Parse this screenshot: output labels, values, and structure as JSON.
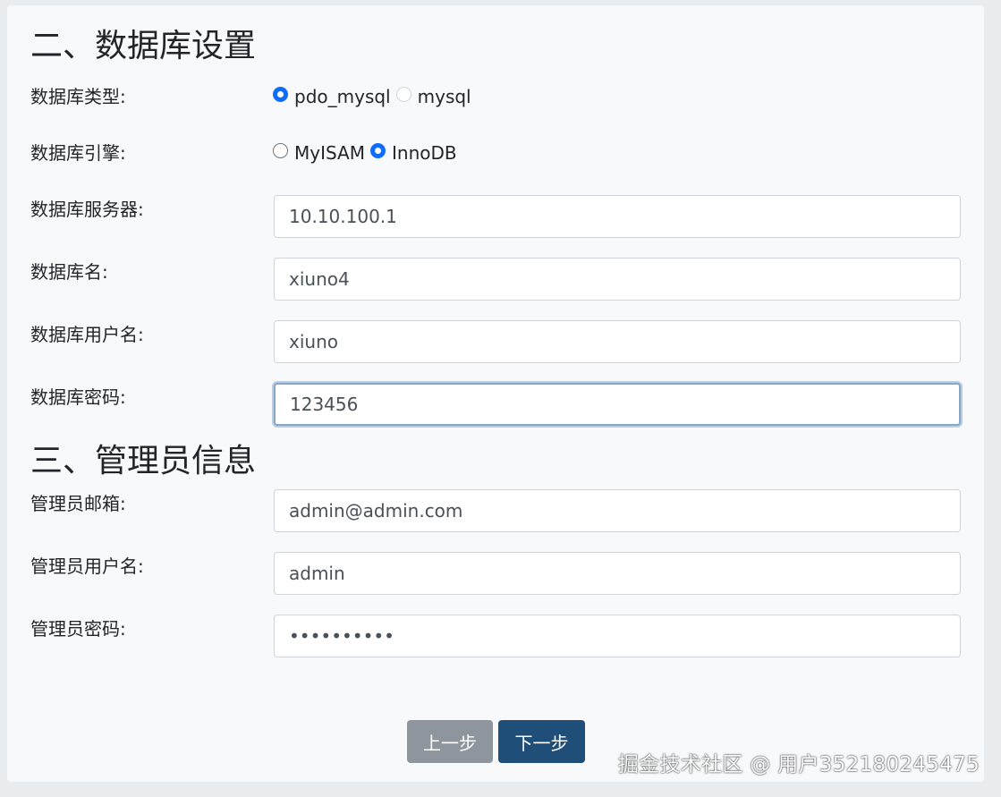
{
  "db_section": {
    "title": "二、数据库设置",
    "type_label": "数据库类型:",
    "type_options": [
      "pdo_mysql",
      "mysql"
    ],
    "type_selected": "pdo_mysql",
    "engine_label": "数据库引擎:",
    "engine_options": [
      "MyISAM",
      "InnoDB"
    ],
    "engine_selected": "InnoDB",
    "server_label": "数据库服务器:",
    "server_value": "10.10.100.1",
    "name_label": "数据库名:",
    "name_value": "xiuno4",
    "user_label": "数据库用户名:",
    "user_value": "xiuno",
    "password_label": "数据库密码:",
    "password_value": "123456"
  },
  "admin_section": {
    "title": "三、管理员信息",
    "email_label": "管理员邮箱:",
    "email_value": "admin@admin.com",
    "username_label": "管理员用户名:",
    "username_value": "admin",
    "password_label": "管理员密码:",
    "password_value": "••••••••••"
  },
  "buttons": {
    "prev": "上一步",
    "next": "下一步"
  },
  "watermark": "掘金技术社区 @ 用户352180245475",
  "colors": {
    "accent": "#0d6efd",
    "next_button": "#1f4e79",
    "prev_button": "#8e959c"
  }
}
